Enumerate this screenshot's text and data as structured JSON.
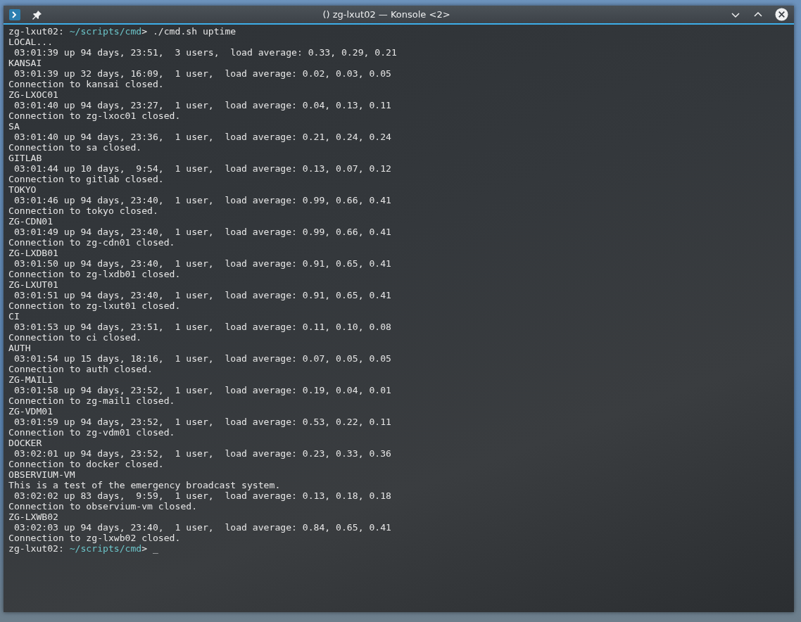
{
  "window": {
    "title": "() zg-lxut02 — Konsole <2>"
  },
  "terminal": {
    "lines": [
      {
        "kind": "prompt",
        "host": "zg-lxut02: ",
        "path": "~/scripts/cmd",
        "command": "> ./cmd.sh uptime"
      },
      {
        "kind": "text",
        "text": "LOCAL..."
      },
      {
        "kind": "text",
        "text": " 03:01:39 up 94 days, 23:51,  3 users,  load average: 0.33, 0.29, 0.21"
      },
      {
        "kind": "text",
        "text": "KANSAI"
      },
      {
        "kind": "text",
        "text": " 03:01:39 up 32 days, 16:09,  1 user,  load average: 0.02, 0.03, 0.05"
      },
      {
        "kind": "text",
        "text": "Connection to kansai closed."
      },
      {
        "kind": "text",
        "text": "ZG-LXOC01"
      },
      {
        "kind": "text",
        "text": " 03:01:40 up 94 days, 23:27,  1 user,  load average: 0.04, 0.13, 0.11"
      },
      {
        "kind": "text",
        "text": "Connection to zg-lxoc01 closed."
      },
      {
        "kind": "text",
        "text": "SA"
      },
      {
        "kind": "text",
        "text": " 03:01:40 up 94 days, 23:36,  1 user,  load average: 0.21, 0.24, 0.24"
      },
      {
        "kind": "text",
        "text": "Connection to sa closed."
      },
      {
        "kind": "text",
        "text": "GITLAB"
      },
      {
        "kind": "text",
        "text": " 03:01:44 up 10 days,  9:54,  1 user,  load average: 0.13, 0.07, 0.12"
      },
      {
        "kind": "text",
        "text": "Connection to gitlab closed."
      },
      {
        "kind": "text",
        "text": "TOKYO"
      },
      {
        "kind": "text",
        "text": " 03:01:46 up 94 days, 23:40,  1 user,  load average: 0.99, 0.66, 0.41"
      },
      {
        "kind": "text",
        "text": "Connection to tokyo closed."
      },
      {
        "kind": "text",
        "text": "ZG-CDN01"
      },
      {
        "kind": "text",
        "text": " 03:01:49 up 94 days, 23:40,  1 user,  load average: 0.99, 0.66, 0.41"
      },
      {
        "kind": "text",
        "text": "Connection to zg-cdn01 closed."
      },
      {
        "kind": "text",
        "text": "ZG-LXDB01"
      },
      {
        "kind": "text",
        "text": " 03:01:50 up 94 days, 23:40,  1 user,  load average: 0.91, 0.65, 0.41"
      },
      {
        "kind": "text",
        "text": "Connection to zg-lxdb01 closed."
      },
      {
        "kind": "text",
        "text": "ZG-LXUT01"
      },
      {
        "kind": "text",
        "text": " 03:01:51 up 94 days, 23:40,  1 user,  load average: 0.91, 0.65, 0.41"
      },
      {
        "kind": "text",
        "text": "Connection to zg-lxut01 closed."
      },
      {
        "kind": "text",
        "text": "CI"
      },
      {
        "kind": "text",
        "text": " 03:01:53 up 94 days, 23:51,  1 user,  load average: 0.11, 0.10, 0.08"
      },
      {
        "kind": "text",
        "text": "Connection to ci closed."
      },
      {
        "kind": "text",
        "text": "AUTH"
      },
      {
        "kind": "text",
        "text": " 03:01:54 up 15 days, 18:16,  1 user,  load average: 0.07, 0.05, 0.05"
      },
      {
        "kind": "text",
        "text": "Connection to auth closed."
      },
      {
        "kind": "text",
        "text": "ZG-MAIL1"
      },
      {
        "kind": "text",
        "text": " 03:01:58 up 94 days, 23:52,  1 user,  load average: 0.19, 0.04, 0.01"
      },
      {
        "kind": "text",
        "text": "Connection to zg-mail1 closed."
      },
      {
        "kind": "text",
        "text": "ZG-VDM01"
      },
      {
        "kind": "text",
        "text": " 03:01:59 up 94 days, 23:52,  1 user,  load average: 0.53, 0.22, 0.11"
      },
      {
        "kind": "text",
        "text": "Connection to zg-vdm01 closed."
      },
      {
        "kind": "text",
        "text": "DOCKER"
      },
      {
        "kind": "text",
        "text": " 03:02:01 up 94 days, 23:52,  1 user,  load average: 0.23, 0.33, 0.36"
      },
      {
        "kind": "text",
        "text": "Connection to docker closed."
      },
      {
        "kind": "text",
        "text": "OBSERVIUM-VM"
      },
      {
        "kind": "text",
        "text": "This is a test of the emergency broadcast system."
      },
      {
        "kind": "text",
        "text": " 03:02:02 up 83 days,  9:59,  1 user,  load average: 0.13, 0.18, 0.18"
      },
      {
        "kind": "text",
        "text": "Connection to observium-vm closed."
      },
      {
        "kind": "text",
        "text": "ZG-LXWB02"
      },
      {
        "kind": "text",
        "text": " 03:02:03 up 94 days, 23:40,  1 user,  load average: 0.84, 0.65, 0.41"
      },
      {
        "kind": "text",
        "text": "Connection to zg-lxwb02 closed."
      },
      {
        "kind": "prompt",
        "host": "zg-lxut02: ",
        "path": "~/scripts/cmd",
        "command": "> ",
        "cursor": "_"
      }
    ]
  }
}
